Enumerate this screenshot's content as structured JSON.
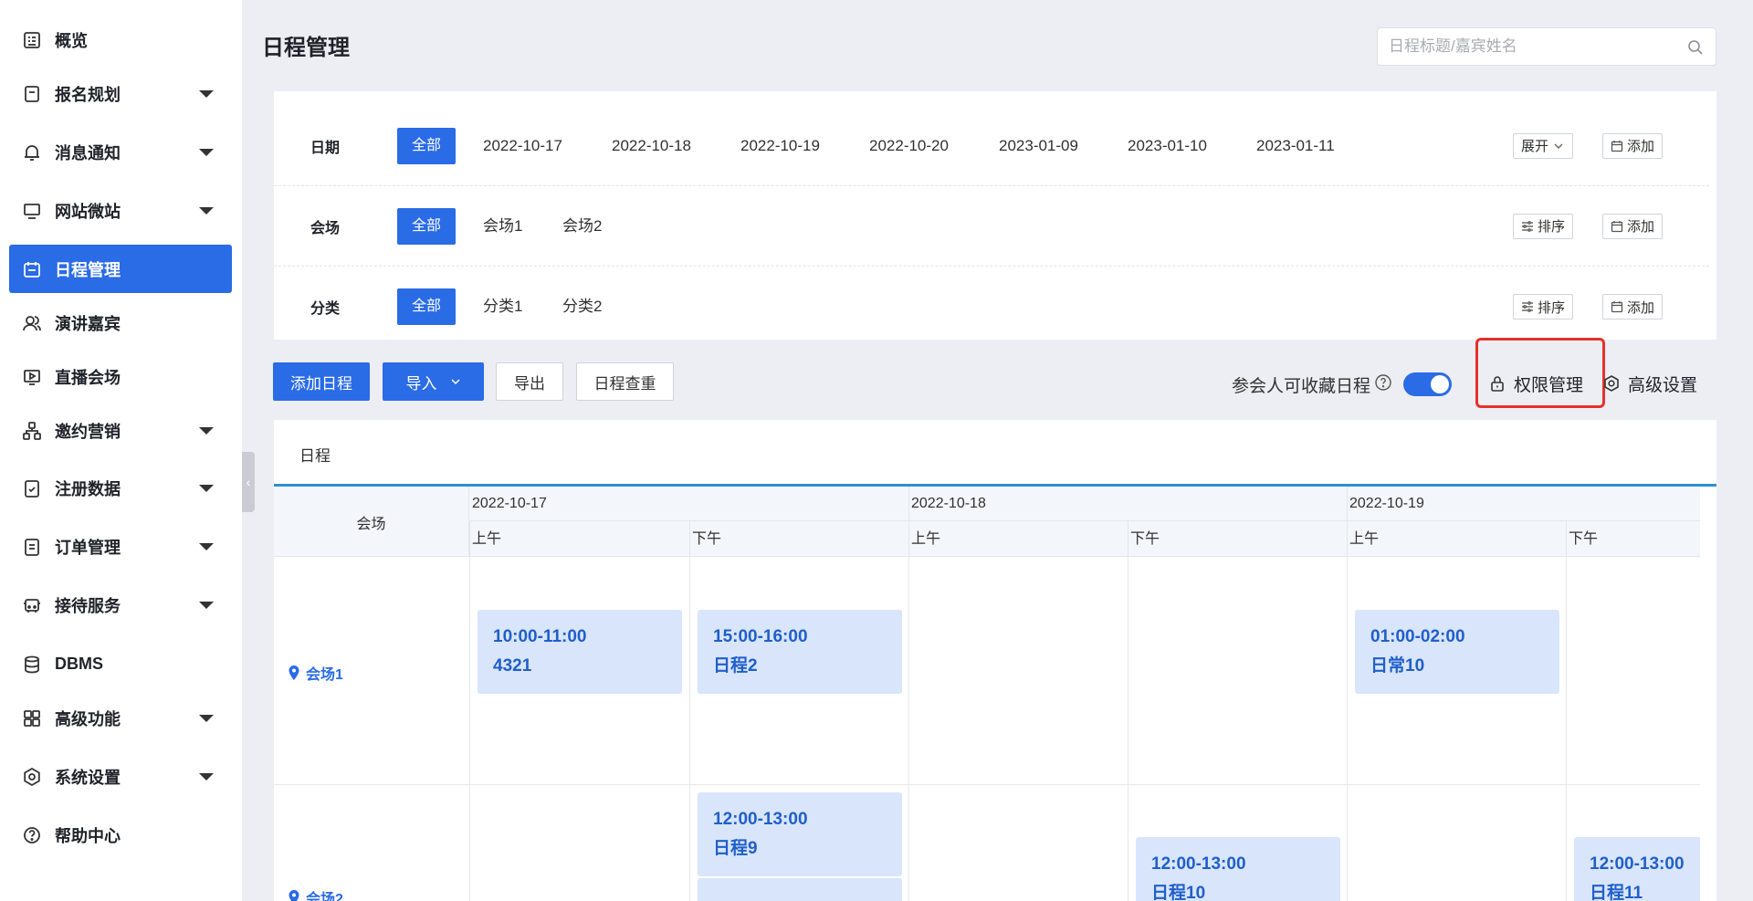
{
  "sidebar": {
    "items": [
      {
        "label": "概览",
        "icon": "overview-icon",
        "expandable": false,
        "active": false
      },
      {
        "label": "报名规划",
        "icon": "registration-icon",
        "expandable": true,
        "active": false
      },
      {
        "label": "消息通知",
        "icon": "bell-icon",
        "expandable": true,
        "active": false
      },
      {
        "label": "网站微站",
        "icon": "monitor-icon",
        "expandable": true,
        "active": false
      },
      {
        "label": "日程管理",
        "icon": "calendar-icon",
        "expandable": false,
        "active": true
      },
      {
        "label": "演讲嘉宾",
        "icon": "users-icon",
        "expandable": false,
        "active": false
      },
      {
        "label": "直播会场",
        "icon": "live-icon",
        "expandable": false,
        "active": false
      },
      {
        "label": "邀约营销",
        "icon": "network-icon",
        "expandable": true,
        "active": false
      },
      {
        "label": "注册数据",
        "icon": "clipboard-check-icon",
        "expandable": true,
        "active": false
      },
      {
        "label": "订单管理",
        "icon": "order-icon",
        "expandable": true,
        "active": false
      },
      {
        "label": "接待服务",
        "icon": "bus-icon",
        "expandable": true,
        "active": false
      },
      {
        "label": "DBMS",
        "icon": "database-icon",
        "expandable": false,
        "active": false
      },
      {
        "label": "高级功能",
        "icon": "grid-icon",
        "expandable": true,
        "active": false
      },
      {
        "label": "系统设置",
        "icon": "settings-icon",
        "expandable": true,
        "active": false
      },
      {
        "label": "帮助中心",
        "icon": "help-icon",
        "expandable": false,
        "active": false
      }
    ]
  },
  "header": {
    "title": "日程管理",
    "search_placeholder": "日程标题/嘉宾姓名"
  },
  "filters": {
    "date": {
      "label": "日期",
      "all": "全部",
      "options": [
        "2022-10-17",
        "2022-10-18",
        "2022-10-19",
        "2022-10-20",
        "2023-01-09",
        "2023-01-10",
        "2023-01-11"
      ],
      "expand_label": "展开",
      "add_label": "添加"
    },
    "venue": {
      "label": "会场",
      "all": "全部",
      "options": [
        "会场1",
        "会场2"
      ],
      "sort_label": "排序",
      "add_label": "添加"
    },
    "category": {
      "label": "分类",
      "all": "全部",
      "options": [
        "分类1",
        "分类2"
      ],
      "sort_label": "排序",
      "add_label": "添加"
    }
  },
  "actions": {
    "add_schedule": "添加日程",
    "import": "导入",
    "export": "导出",
    "dedupe": "日程查重",
    "collect_label": "参会人可收藏日程",
    "collect_enabled": true,
    "permission": "权限管理",
    "advanced": "高级设置"
  },
  "schedule": {
    "tab": "日程",
    "venue_header": "会场",
    "dates": [
      "2022-10-17",
      "2022-10-18",
      "2022-10-19"
    ],
    "am": "上午",
    "pm": "下午",
    "venues": [
      "会场1",
      "会场2"
    ],
    "events": [
      {
        "time": "10:00-11:00",
        "title": "4321"
      },
      {
        "time": "15:00-16:00",
        "title": "日程2"
      },
      {
        "time": "01:00-02:00",
        "title": "日常10"
      },
      {
        "time": "12:00-13:00",
        "title": "日程9"
      },
      {
        "time": "12:00-13:00",
        "title": "日程10"
      },
      {
        "time": "12:00-13:00",
        "title": "日程11"
      }
    ]
  }
}
